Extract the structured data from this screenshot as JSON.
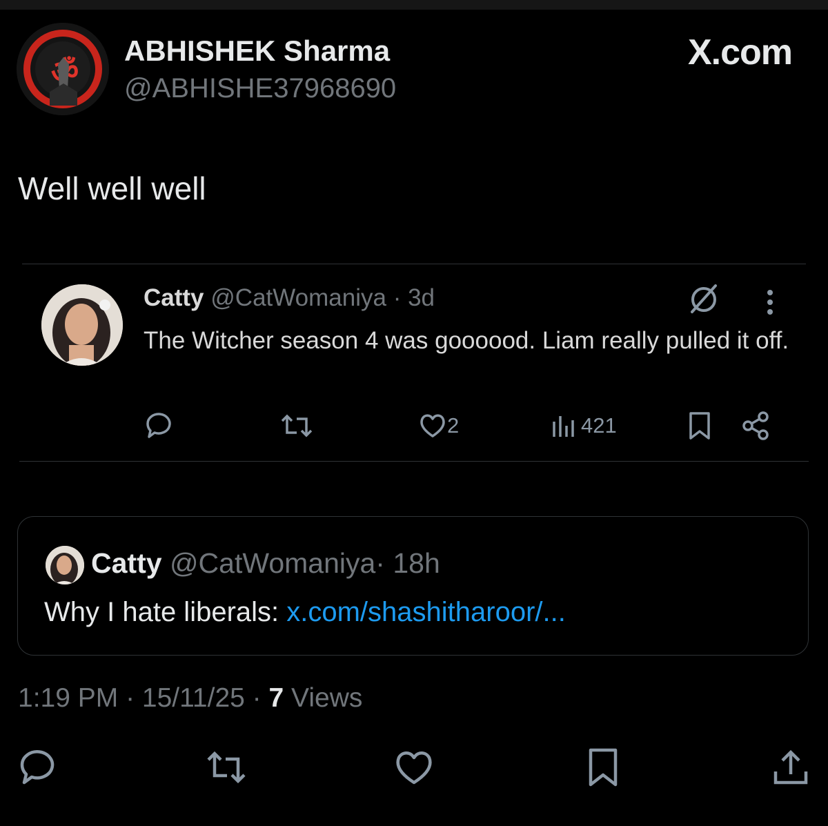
{
  "author": {
    "name": "ABHISHEK Sharma",
    "handle": "@ABHISHE37968690"
  },
  "brand": "X.com",
  "tweet_text": "Well well well",
  "embedded": {
    "name": "Catty",
    "handle": "@CatWomaniya",
    "time": "· 3d",
    "text": "The Witcher season 4 was goooood. Liam really pulled it off.",
    "likes": "2",
    "views": "421",
    "icons": [
      "reply-icon",
      "retweet-icon",
      "heart-icon",
      "views-icon",
      "bookmark-icon",
      "share-icon",
      "grok-icon",
      "more-icon"
    ]
  },
  "quote": {
    "name": "Catty",
    "handle": "@CatWomaniya",
    "time": "· 18h",
    "text": "Why I hate liberals: ",
    "link": "x.com/shashitharoor/..."
  },
  "meta": {
    "time": "1:19 PM",
    "date": "· 15/11/25 ·",
    "views_count": "7",
    "views_label": "Views"
  },
  "colors": {
    "background": "#000000",
    "text": "#e7e9ea",
    "muted": "#71767b",
    "link": "#1d9bf0",
    "avatar_accent": "#d42a20"
  }
}
